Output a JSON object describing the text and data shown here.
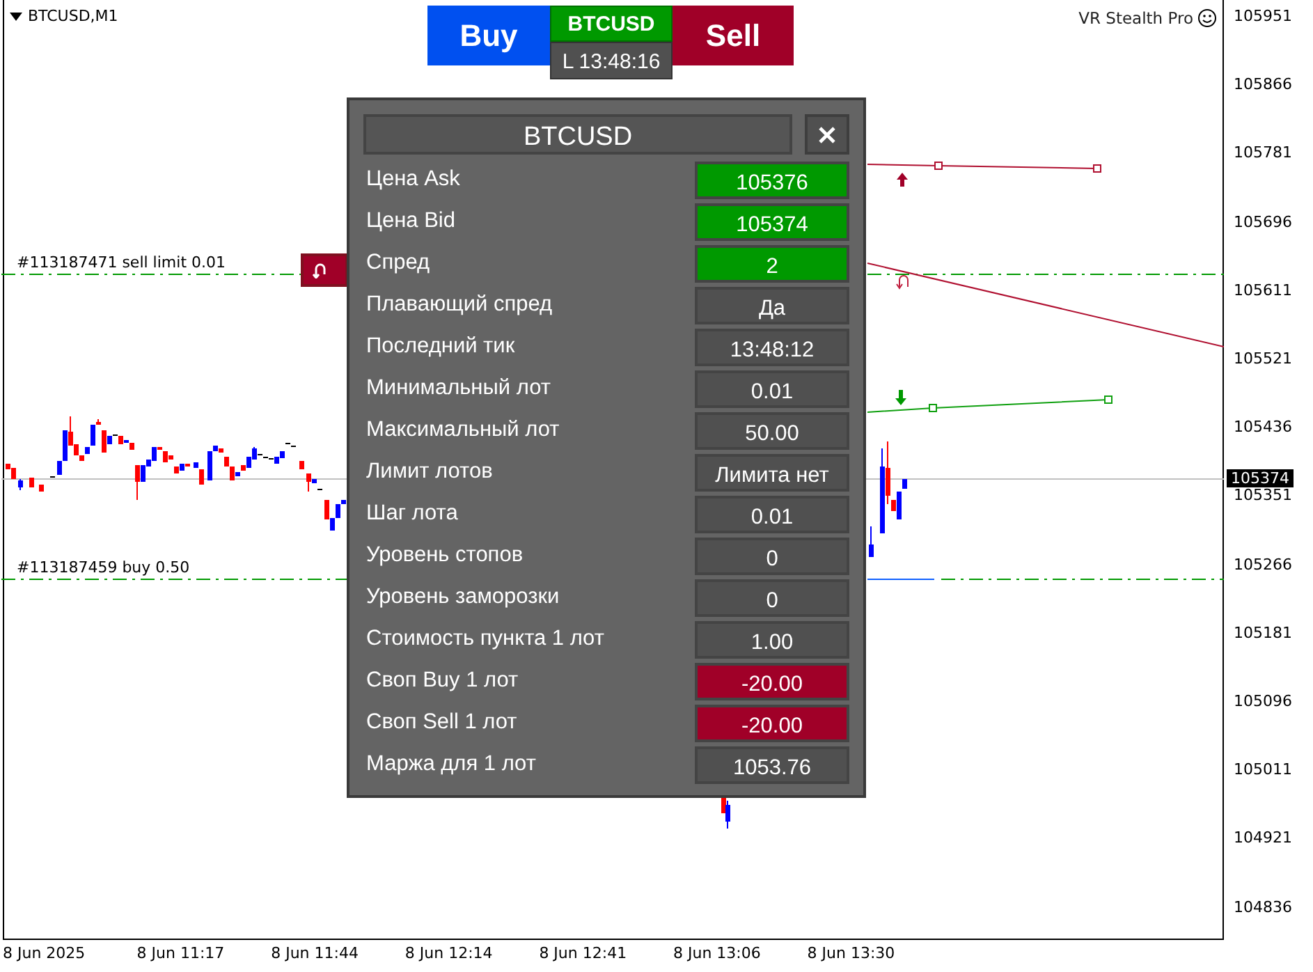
{
  "chart": {
    "symbol": "BTCUSD,M1",
    "indicator": "VR Stealth Pro",
    "orders": [
      {
        "label": "#113187471 sell limit 0.01"
      },
      {
        "label": "#113187459 buy 0.50"
      }
    ],
    "price_axis": [
      "105951",
      "105866",
      "105781",
      "105696",
      "105611",
      "105521",
      "105436",
      "105351",
      "105266",
      "105181",
      "105096",
      "105011",
      "104921",
      "104836"
    ],
    "current_price": "105374",
    "time_axis": [
      "8 Jun 2025",
      "8 Jun 11:17",
      "8 Jun 11:44",
      "8 Jun 12:14",
      "8 Jun 12:41",
      "8 Jun 13:06",
      "8 Jun 13:30"
    ]
  },
  "trade_buttons": {
    "buy": "Buy",
    "symbol": "BTCUSD",
    "time": "L 13:48:16",
    "sell": "Sell"
  },
  "panel": {
    "title": "BTCUSD",
    "rows": [
      {
        "label": "Цена Ask",
        "value": "105376",
        "color": "#009900"
      },
      {
        "label": "Цена Bid",
        "value": "105374",
        "color": "#009900"
      },
      {
        "label": "Спред",
        "value": "2",
        "color": "#009900"
      },
      {
        "label": "Плавающий спред",
        "value": "Да",
        "color": "#505050"
      },
      {
        "label": "Последний тик",
        "value": "13:48:12",
        "color": "#505050"
      },
      {
        "label": "Минимальный лот",
        "value": "0.01",
        "color": "#505050"
      },
      {
        "label": "Максимальный лот",
        "value": "50.00",
        "color": "#505050"
      },
      {
        "label": "Лимит лотов",
        "value": "Лимита нет",
        "color": "#505050"
      },
      {
        "label": "Шаг лота",
        "value": "0.01",
        "color": "#505050"
      },
      {
        "label": "Уровень стопов",
        "value": "0",
        "color": "#505050"
      },
      {
        "label": "Уровень заморозки",
        "value": "0",
        "color": "#505050"
      },
      {
        "label": "Стоимость пункта 1 лот",
        "value": "1.00",
        "color": "#505050"
      },
      {
        "label": "Своп Buy 1 лот",
        "value": "-20.00",
        "color": "#a00028"
      },
      {
        "label": "Своп Sell 1 лот",
        "value": "-20.00",
        "color": "#a00028"
      },
      {
        "label": "Маржа для 1 лот",
        "value": "1053.76",
        "color": "#505050"
      }
    ]
  }
}
